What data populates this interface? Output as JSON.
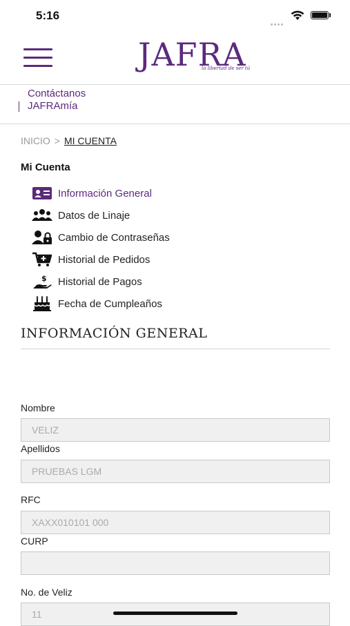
{
  "status": {
    "time": "5:16"
  },
  "header": {
    "logo_text": "JAFRA",
    "logo_tagline": "la libertad de ser tú"
  },
  "links": {
    "contact": "Contáctanos",
    "jafra_mia": "JAFRAmía"
  },
  "breadcrumb": {
    "home": "INICIO",
    "separator": ">",
    "current": "MI CUENTA"
  },
  "section_title": "Mi Cuenta",
  "menu": [
    {
      "label": "Información General",
      "icon": "id-card-icon",
      "active": true
    },
    {
      "label": "Datos de Linaje",
      "icon": "users-icon",
      "active": false
    },
    {
      "label": "Cambio de Contraseñas",
      "icon": "user-lock-icon",
      "active": false
    },
    {
      "label": "Historial de Pedidos",
      "icon": "cart-icon",
      "active": false
    },
    {
      "label": "Historial de Pagos",
      "icon": "payment-hand-icon",
      "active": false
    },
    {
      "label": "Fecha de Cumpleaños",
      "icon": "birthday-cake-icon",
      "active": false
    }
  ],
  "page_heading": "INFORMACIÓN GENERAL",
  "form": {
    "nombre_label": "Nombre",
    "nombre_value": "VELIZ",
    "apellidos_label": "Apellidos",
    "apellidos_value": "PRUEBAS LGM",
    "rfc_label": "RFC",
    "rfc_value": "XAXX010101 000",
    "curp_label": "CURP",
    "curp_value": "",
    "numero_label": "No. de Veliz",
    "numero_value": "11"
  },
  "colors": {
    "brand": "#5b2a7c",
    "active_icon": "#5b2a7c",
    "icon": "#111111"
  }
}
